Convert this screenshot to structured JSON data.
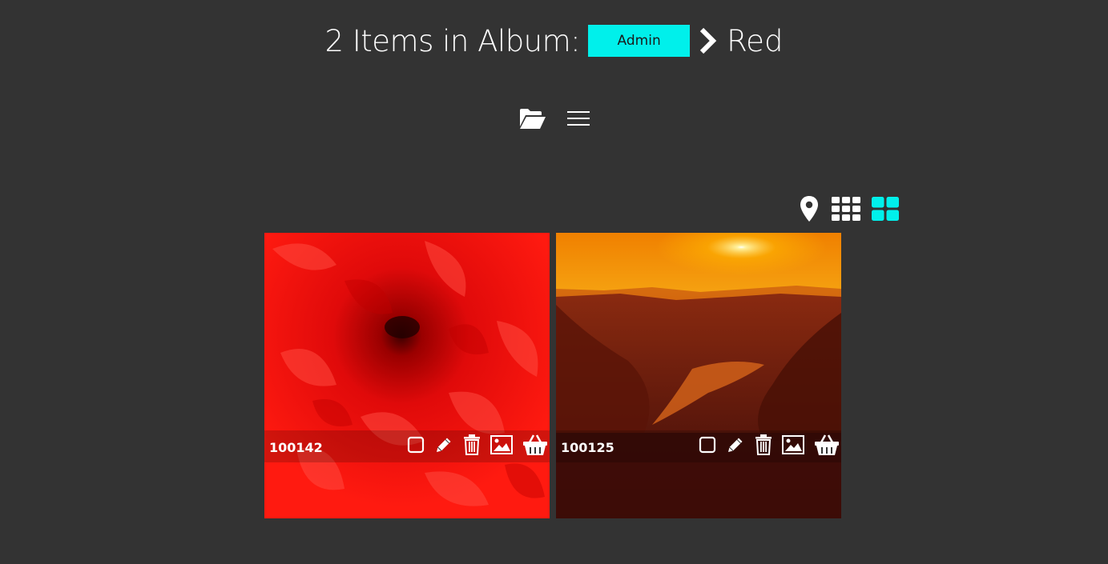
{
  "header": {
    "title": "2 Items in Album:",
    "album_button": "Admin",
    "current_album": "Red",
    "accent": "#00f0eb"
  },
  "toolbar": {
    "icons": [
      "folder-open-icon",
      "hamburger-menu-icon"
    ]
  },
  "view_controls": {
    "icons": [
      "map-pin-icon",
      "small-grid-icon",
      "large-grid-icon"
    ],
    "active": "large-grid-icon"
  },
  "items": [
    {
      "id": "100142",
      "image": "red-flower"
    },
    {
      "id": "100125",
      "image": "canyon-sunset"
    }
  ],
  "card_actions": [
    "checkbox-icon",
    "pencil-icon",
    "trash-icon",
    "image-icon",
    "basket-icon"
  ]
}
